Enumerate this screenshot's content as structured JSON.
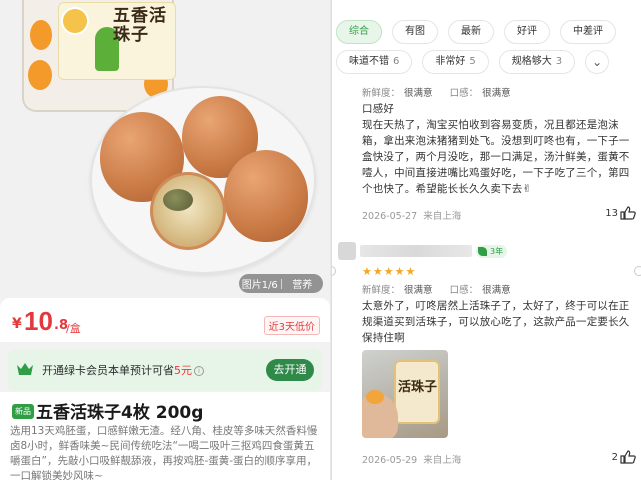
{
  "left": {
    "image": {
      "package_text": "五香活珠子",
      "counter": "图片1/6",
      "tab": "营养"
    },
    "price": {
      "symbol": "¥",
      "integer": "10",
      "decimal": ".8",
      "unit": "/盒",
      "tag": "近3天低价"
    },
    "member": {
      "text_before": "开通绿卡会员本单预计可省",
      "amount": "5元",
      "info": "i",
      "button": "去开通"
    },
    "product": {
      "new_tag": "新品",
      "title": "五香活珠子4枚 200g",
      "description": "选用13天鸡胚蛋，口感鲜嫩无渣。经八角、桂皮等多味天然香料慢卤8小时，鲜香味美~民间传统吃法“一喝二吸叶三抠鸡四食蛋黄五嚼蛋白”，先敲小口吸鲜靓舔液，再按鸡胚-蛋黄-蛋白的顺序享用，一口解锁美妙风味~"
    }
  },
  "right": {
    "filters_row1": [
      {
        "label": "综合",
        "count": "",
        "active": true
      },
      {
        "label": "有图",
        "count": "",
        "active": false
      },
      {
        "label": "最新",
        "count": "",
        "active": false
      },
      {
        "label": "好评",
        "count": "",
        "active": false
      },
      {
        "label": "中差评",
        "count": "",
        "active": false
      }
    ],
    "filters_row2": [
      {
        "label": "味道不错",
        "count": "6"
      },
      {
        "label": "非常好",
        "count": "5"
      },
      {
        "label": "规格够大",
        "count": "3"
      }
    ],
    "more_icon": "chevron-down-icon",
    "reviews": [
      {
        "fresh_label": "新鲜度：",
        "fresh_value": "很满意",
        "taste_label": "口感：",
        "taste_value": "很满意",
        "body": "口感好\n现在天热了，淘宝买怕收到容易变质，况且都还是泡沫箱，拿出来泡沫猪猪到处飞。没想到叮咚也有，一下子一盒快没了，两个月没吃，那一口满足，汤汁鲜美，蛋黄不噎人，中间直接进嘴比鸡蛋好吃，一下子吃了三个，第四个也快了。希望能长长久久卖下去✌",
        "date": "2026-05-27",
        "location": "来自上海",
        "likes": "13"
      },
      {
        "level": "3年",
        "stars": "★★★★★",
        "fresh_label": "新鲜度：",
        "fresh_value": "很满意",
        "taste_label": "口感：",
        "taste_value": "很满意",
        "body": "太意外了，叮咚居然上活珠子了，太好了，终于可以在正规渠道买到活珠子，可以放心吃了，这款产品一定要长久保持住啊",
        "photo_text": "活珠子",
        "date": "2026-05-29",
        "location": "来自上海",
        "likes": "2"
      }
    ]
  }
}
